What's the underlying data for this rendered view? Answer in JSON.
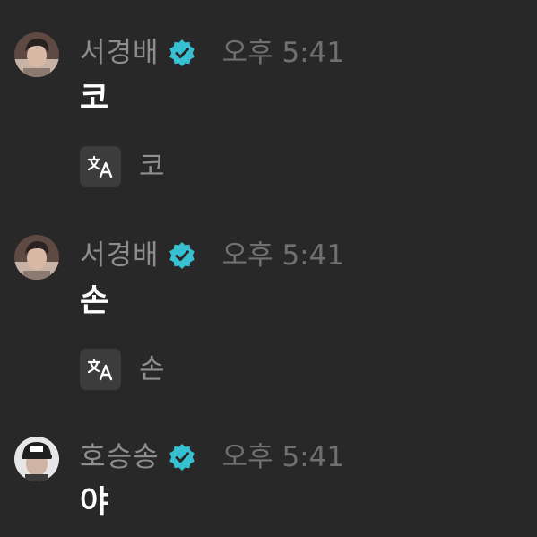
{
  "messages": [
    {
      "sender": "서경배",
      "verified": true,
      "time": "오후 5:41",
      "text": "코",
      "translation": "코",
      "avatar_icon": "user-avatar",
      "avatar_color": "#8a6f62"
    },
    {
      "sender": "서경배",
      "verified": true,
      "time": "오후 5:41",
      "text": "손",
      "translation": "손",
      "avatar_icon": "user-avatar",
      "avatar_color": "#8a6f62"
    },
    {
      "sender": "호승송",
      "verified": true,
      "time": "오후 5:41",
      "text": "야",
      "translation": null,
      "avatar_icon": "user-avatar",
      "avatar_color": "#d9d9d9"
    }
  ],
  "icons": {
    "verified": "verified-badge-icon",
    "translate": "translate-icon"
  },
  "colors": {
    "background": "#282828",
    "verified_badge": "#37bfd2",
    "sender_name": "#8d8d8d",
    "message_text": "#ffffff"
  }
}
